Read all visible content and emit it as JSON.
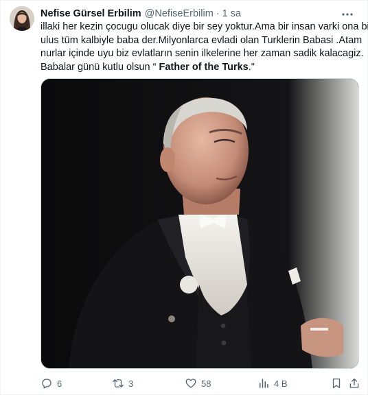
{
  "author": {
    "name": "Nefise Gürsel Erbilim",
    "handle": "@NefiseErbilim",
    "separator": "·",
    "time": "1 sa"
  },
  "tweet": {
    "line1": "illaki her kezin çocugu olucak  diye bir sey yoktur.Ama bir insan varki ona bir",
    "line2": "ulus tüm kalbiyle baba der.Milyonlarca evladi olan Turklerin Babasi .Atam",
    "line3": "nurlar içinde uyu biz evlatların senin ilkelerine her zaman sadik kalacagiz.",
    "line4_prefix": "Babalar günü kutlu olsun “ ",
    "line4_bold": "Father of the Turks",
    "line4_suffix": ".\""
  },
  "actions": {
    "replies": "6",
    "reposts": "3",
    "likes": "58",
    "views": "4 B"
  },
  "icons": {
    "more": "more-dots-icon",
    "reply": "reply-bubble-icon",
    "repost": "repost-icon",
    "like": "heart-icon",
    "views": "views-bars-icon",
    "bookmark": "bookmark-icon",
    "share": "share-icon"
  },
  "colors": {
    "text": "#0f1419",
    "secondary": "#536471",
    "border": "#cfd9de"
  }
}
